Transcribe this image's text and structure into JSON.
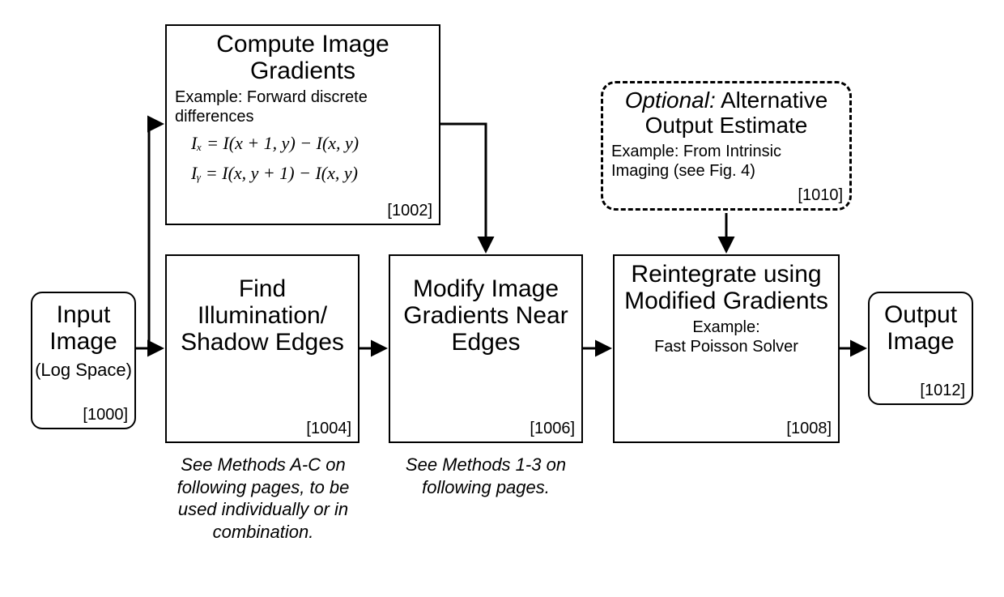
{
  "nodes": {
    "input": {
      "title": "Input Image",
      "sub": "(Log Space)",
      "ref": "[1000]"
    },
    "compute": {
      "title": "Compute Image Gradients",
      "sub": "Example: Forward discrete differences",
      "formula1": "Iₓ   =   I(x + 1, y) − I(x, y)",
      "formula2": "Iᵧ   =   I(x, y + 1) − I(x, y)",
      "ref": "[1002]"
    },
    "find": {
      "title": "Find Illumination/ Shadow Edges",
      "ref": "[1004]"
    },
    "modify": {
      "title": "Modify Image Gradients Near Edges",
      "ref": "[1006]"
    },
    "reintegrate": {
      "title": "Reintegrate using Modified Gradients",
      "sub": "Example:\nFast Poisson Solver",
      "ref": "[1008]"
    },
    "optional": {
      "title_italic": "Optional:",
      "title_rest": " Alternative Output Estimate",
      "sub": "Example: From Intrinsic Imaging (see Fig. 4)",
      "ref": "[1010]"
    },
    "output": {
      "title": "Output Image",
      "ref": "[1012]"
    }
  },
  "captions": {
    "find": "See Methods A-C on following pages, to be used individually or in combination.",
    "modify": "See Methods 1-3 on following pages."
  }
}
